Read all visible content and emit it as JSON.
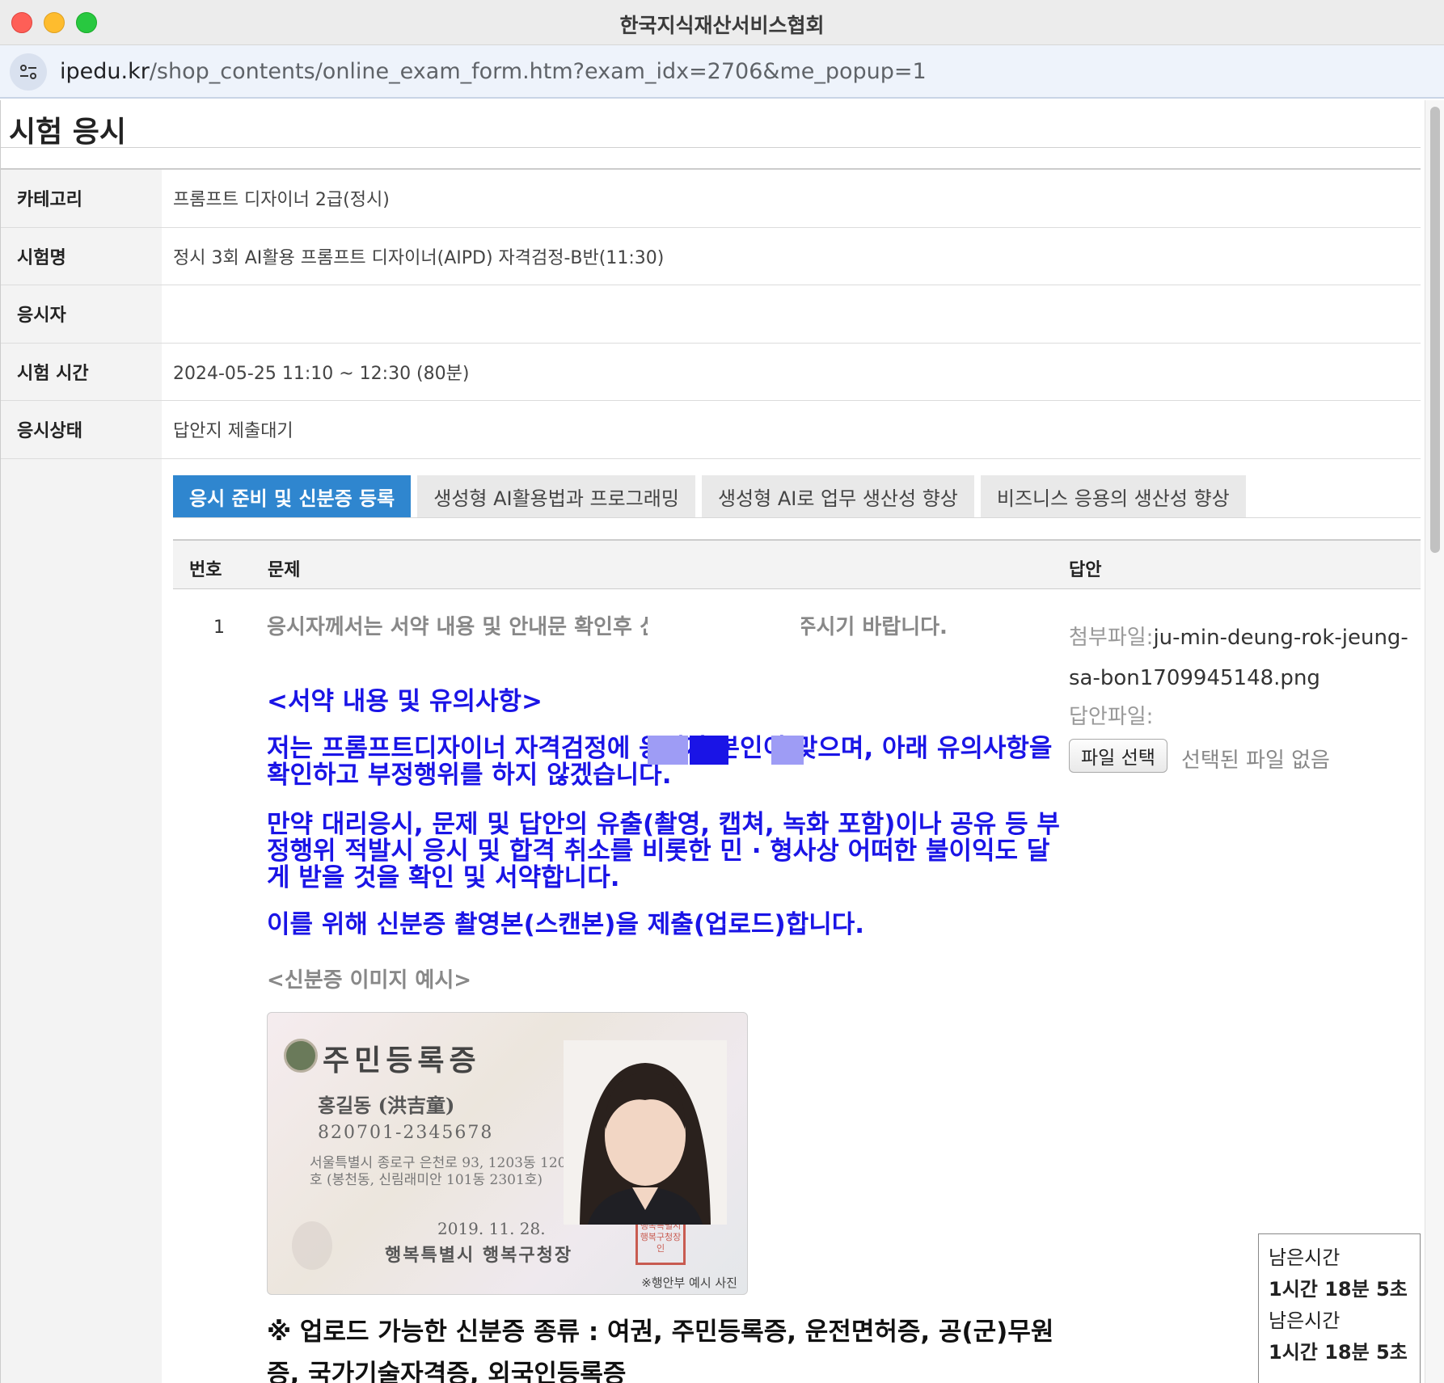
{
  "window": {
    "title": "한국지식재산서비스협회",
    "url_host": "ipedu.kr",
    "url_path": "/shop_contents/online_exam_form.htm?exam_idx=2706&me_popup=1"
  },
  "page_title": "시험 응시",
  "info": [
    {
      "label": "카테고리",
      "value": "프롬프트 디자이너 2급(정시)"
    },
    {
      "label": "시험명",
      "value": "정시 3회 AI활용 프롬프트 디자이너(AIPD) 자격검정-B반(11:30)"
    },
    {
      "label": "응시자",
      "value": ""
    },
    {
      "label": "시험 시간",
      "value": "2024-05-25 11:10 ~ 12:30 (80분)"
    },
    {
      "label": "응시상태",
      "value": "답안지 제출대기"
    }
  ],
  "tabs": [
    {
      "label": "응시 준비 및 신분증 등록",
      "active": true
    },
    {
      "label": "생성형 AI활용법과 프로그래밍",
      "active": false
    },
    {
      "label": "생성형 AI로 업무 생산성 향상",
      "active": false
    },
    {
      "label": "비즈니스 응용의 생산성 향상",
      "active": false
    }
  ],
  "table_headers": {
    "number": "번호",
    "question": "문제",
    "answer": "답안"
  },
  "question": {
    "number": "1",
    "text": "응시자께서는 서약 내용 및 안내문 확인후 신                    로 업로드하여 주시기 바랍니다.",
    "pledge_title": "<서약 내용 및 유의사항>",
    "pledge_1": "저는 프롬프트디자이너 자격검정에                  응시자 본인이 맞으며, 아래 유의사항을 확인하고 부정행위를 하지 않겠습니다.",
    "pledge_2": "만약 대리응시, 문제 및 답안의 유출(촬영, 캡쳐, 녹화 포함)이나 공유 등 부정행위 적발시 응시 및 합격 취소를 비롯한 민 · 형사상 어떠한 불이익도 달게 받을 것을 확인 및 서약합니다.",
    "pledge_3": "이를 위해 신분증 촬영본(스캔본)을 제출(업로드)합니다.",
    "example_caption": "<신분증 이미지 예시>",
    "upload_types": "※ 업로드 가능한 신분증 종류 : 여권, 주민등록증, 운전면허증, 공(군)무원증, 국가기술자격증, 외국인등록증"
  },
  "id_card": {
    "title": "주민등록증",
    "name": "홍길동 (洪吉童)",
    "rrn": "820701-2345678",
    "address": "서울특별시 종로구 은천로 93, 1203동 1204호 (봉천동, 신림래미안 101동 2301호)",
    "date": "2019. 11. 28.",
    "issuer": "행복특별시 행복구청장",
    "seal": "행복특별시 행복구청장 인",
    "note": "※행안부 예시 사진"
  },
  "answer": {
    "attach_label": "첨부파일:",
    "attach_file": "ju-min-deung-rok-jeung-sa-bon1709945148.png",
    "answer_file_label": "답안파일:",
    "choose_file_button": "파일 선택",
    "no_file_text": "선택된 파일 없음"
  },
  "timer": {
    "label_1": "남은시간",
    "value_1": "1시간 18분 5초",
    "label_2": "남은시간",
    "value_2": "1시간 18분 5초"
  },
  "colors": {
    "tab_active": "#2f86cf",
    "pledge_text": "#1a14e6",
    "header_bg": "#f3f3f3"
  }
}
